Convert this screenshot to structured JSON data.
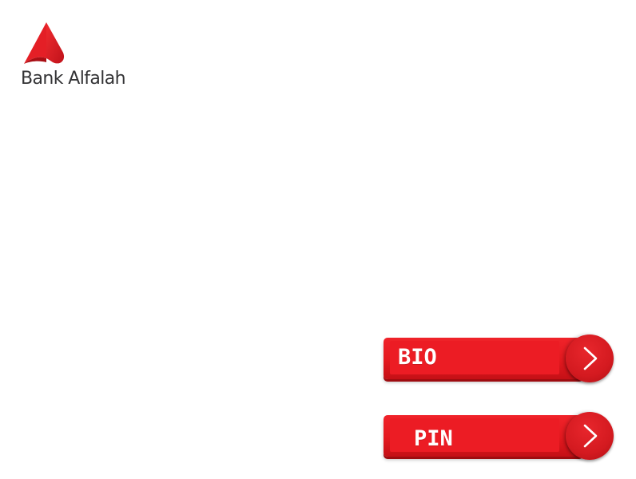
{
  "brand": {
    "name": "Bank Alfalah",
    "logo_icon": "bank-alfalah-logo-icon",
    "brand_color": "#ec1c24"
  },
  "menu": {
    "buttons": [
      {
        "label": "BIO",
        "icon": "chevron-right-icon"
      },
      {
        "label": "PIN",
        "icon": "chevron-right-icon"
      }
    ]
  }
}
